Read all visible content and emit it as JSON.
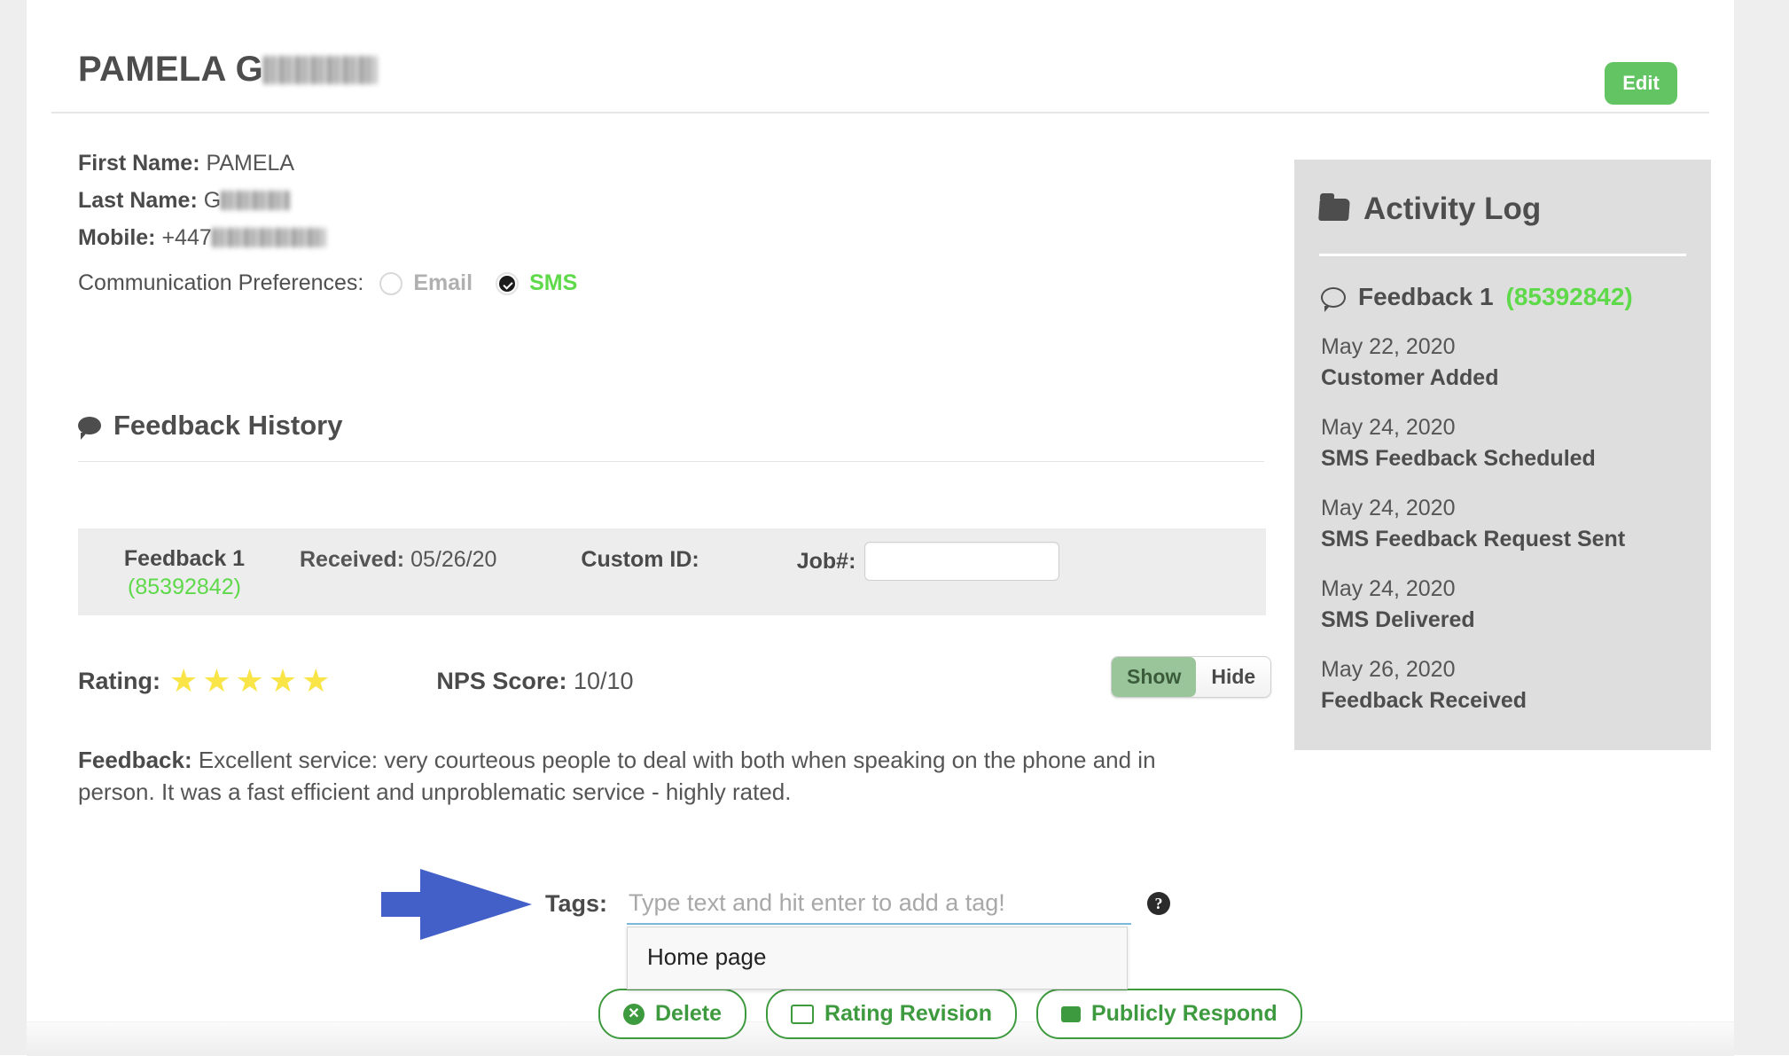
{
  "header": {
    "title_prefix": "PAMELA G",
    "title_redacted": true,
    "edit_label": "Edit"
  },
  "customer": {
    "first_name_label": "First Name:",
    "first_name_value": "PAMELA",
    "last_name_label": "Last Name:",
    "last_name_value": "G",
    "mobile_label": "Mobile:",
    "mobile_value": "+447",
    "comm_pref_label": "Communication Preferences:",
    "comm_options": [
      {
        "label": "Email",
        "selected": false
      },
      {
        "label": "SMS",
        "selected": true
      }
    ]
  },
  "feedback_history": {
    "section_title": "Feedback History",
    "feedback_number": "Feedback 1",
    "feedback_id": "(85392842)",
    "received_label": "Received:",
    "received_value": "05/26/20",
    "custom_id_label": "Custom ID:",
    "custom_id_value": "",
    "job_label": "Job#:",
    "job_value": "",
    "rating_label": "Rating:",
    "rating_stars": 5,
    "star_glyph": "★",
    "nps_label": "NPS Score:",
    "nps_value": "10/10",
    "visibility_toggle": {
      "show_label": "Show",
      "hide_label": "Hide",
      "selected": "Show"
    },
    "feedback_label": "Feedback:",
    "feedback_text": "Excellent service: very courteous people to deal with both when speaking on the phone and in person. It was a fast efficient and unproblematic service - highly rated."
  },
  "tags": {
    "label": "Tags:",
    "placeholder": "Type text and hit enter to add a tag!",
    "value": "",
    "help_glyph": "?",
    "suggestions": [
      "Home page"
    ]
  },
  "actions": [
    {
      "label": "Delete",
      "icon": "circle-x-icon"
    },
    {
      "label": "Rating Revision",
      "icon": "square-outline-icon"
    },
    {
      "label": "Publicly Respond",
      "icon": "square-filled-icon"
    }
  ],
  "activity_log": {
    "title": "Activity Log",
    "feedback_label": "Feedback 1",
    "feedback_id": "(85392842)",
    "entries": [
      {
        "date": "May 22, 2020",
        "event": "Customer Added"
      },
      {
        "date": "May 24, 2020",
        "event": "SMS Feedback Scheduled"
      },
      {
        "date": "May 24, 2020",
        "event": "SMS Feedback Request Sent"
      },
      {
        "date": "May 24, 2020",
        "event": "SMS Delivered"
      },
      {
        "date": "May 26, 2020",
        "event": "Feedback Received"
      }
    ]
  },
  "colors": {
    "brand_green": "#62c462",
    "accent_green": "#5ed94a",
    "button_green": "#3e9a3e",
    "star_yellow": "#f9e547",
    "panel_gray": "#dedede",
    "arrow_blue": "#4260c8"
  }
}
